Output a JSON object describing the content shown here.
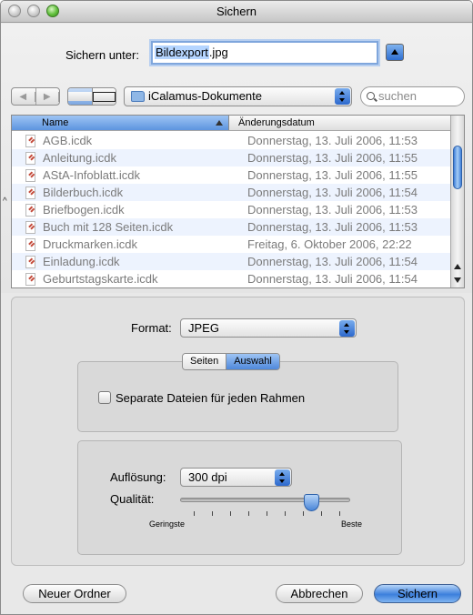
{
  "window": {
    "title": "Sichern"
  },
  "saveas": {
    "label": "Sichern unter:",
    "filename_base": "Bildexport",
    "filename_ext": ".jpg"
  },
  "toolbar": {
    "back_icon": "chevron-left-icon",
    "forward_icon": "chevron-right-icon",
    "folder": "iCalamus-Dokumente",
    "search_placeholder": "suchen"
  },
  "browser": {
    "columns": {
      "name": "Name",
      "date": "Änderungsdatum"
    },
    "files": [
      {
        "name": "AGB.icdk",
        "date": "Donnerstag, 13. Juli 2006, 11:53"
      },
      {
        "name": "Anleitung.icdk",
        "date": "Donnerstag, 13. Juli 2006, 11:55"
      },
      {
        "name": "AStA-Infoblatt.icdk",
        "date": "Donnerstag, 13. Juli 2006, 11:55"
      },
      {
        "name": "Bilderbuch.icdk",
        "date": "Donnerstag, 13. Juli 2006, 11:54"
      },
      {
        "name": "Briefbogen.icdk",
        "date": "Donnerstag, 13. Juli 2006, 11:53"
      },
      {
        "name": "Buch mit 128 Seiten.icdk",
        "date": "Donnerstag, 13. Juli 2006, 11:53"
      },
      {
        "name": "Druckmarken.icdk",
        "date": "Freitag, 6. Oktober 2006, 22:22"
      },
      {
        "name": "Einladung.icdk",
        "date": "Donnerstag, 13. Juli 2006, 11:54"
      },
      {
        "name": "Geburtstagskarte.icdk",
        "date": "Donnerstag, 13. Juli 2006, 11:54"
      }
    ]
  },
  "format": {
    "label": "Format:",
    "value": "JPEG"
  },
  "tabs": {
    "pages": "Seiten",
    "selection": "Auswahl"
  },
  "separate": {
    "label": "Separate Dateien für jeden Rahmen",
    "checked": false
  },
  "resolution": {
    "label": "Auflösung:",
    "value": "300 dpi"
  },
  "quality": {
    "label": "Qualität:",
    "min_label": "Geringste",
    "max_label": "Beste",
    "level": 0.77,
    "tick_count": 9
  },
  "buttons": {
    "new_folder": "Neuer Ordner",
    "cancel": "Abbrechen",
    "save": "Sichern"
  },
  "colors": {
    "accent": "#3c7fdc",
    "row_alt": "#edf3fe"
  }
}
